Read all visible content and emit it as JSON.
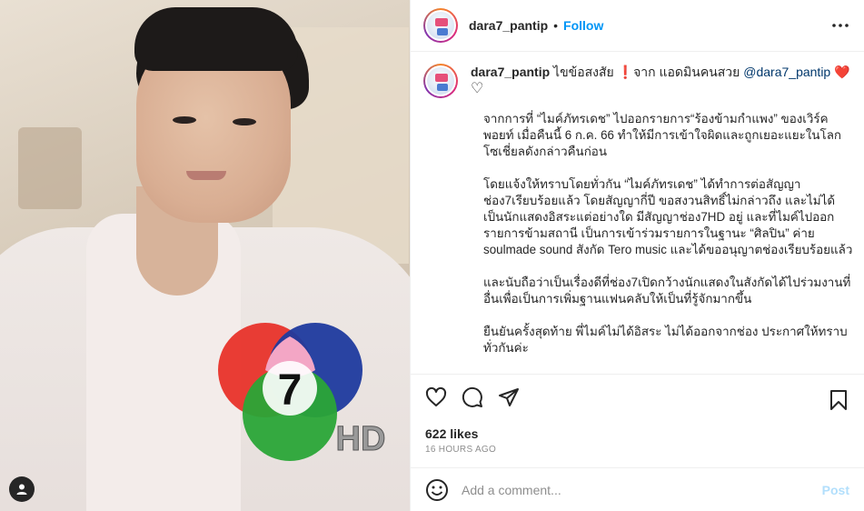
{
  "post": {
    "username": "dara7_pantip",
    "separator": "•",
    "follow_label": "Follow",
    "more_icon": "more-horizontal-icon"
  },
  "caption": {
    "username": "dara7_pantip",
    "intro": " ไขข้อสงสัย ❗จาก แอดมินคนสวย ",
    "mention": "@dara7_pantip",
    "heart": " ❤️",
    "heart_outline": "♡",
    "paragraphs": [
      "จากการที่ “ไมค์ภัทรเดช” ไปออกรายการ“ร้องข้ามกำแพง” ของเวิร์คพอยท์ เมื่อคืนนี้ 6 ก.ค. 66 ทำให้มีการเข้าใจผิดและถูกเยอะแยะในโลกโซเชี่ยลดังกล่าวคืนก่อน",
      "โดยแจ้งให้ทราบโดยทั่วกัน “ไมค์ภัทรเดช” ได้ทำการต่อสัญญาช่อง7เรียบร้อยแล้ว โดยสัญญากี่ปี ขอสงวนสิทธิ์ไม่กล่าวถึง และไม่ได้เป็นนักแสดงอิสระแต่อย่างใด มีสัญญาช่อง7HD อยู่ และที่ไมค์ไปออกรายการข้ามสถานี เป็นการเข้าร่วมรายการในฐานะ “ศิลปิน” ค่าย soulmade sound สังกัด Tero music และได้ขออนุญาตช่องเรียบร้อยแล้ว",
      "และนับถือว่าเป็นเรื่องดีที่ช่อง7เปิดกว้างนักแสดงในสังกัดได้ไปร่วมงานที่อื่นเพื่อเป็นการเพิ่มฐานแฟนคลับให้เป็นที่รู้จักมากขึ้น",
      "ยืนยันครั้งสุดท้าย พี่ไมค์ไม่ได้อิสระ ไม่ได้ออกจากช่อง ประกาศให้ทราบทั่วกันค่ะ"
    ]
  },
  "stats": {
    "likes": "622 likes",
    "time_ago": "16 HOURS AGO"
  },
  "comment": {
    "placeholder": "Add a comment...",
    "post_label": "Post"
  },
  "logo": {
    "number": "7",
    "suffix": "HD"
  },
  "colors": {
    "follow": "#0095f6",
    "post_disabled": "#b2dffc",
    "mention": "#00376b",
    "heart": "#ed1c39"
  }
}
